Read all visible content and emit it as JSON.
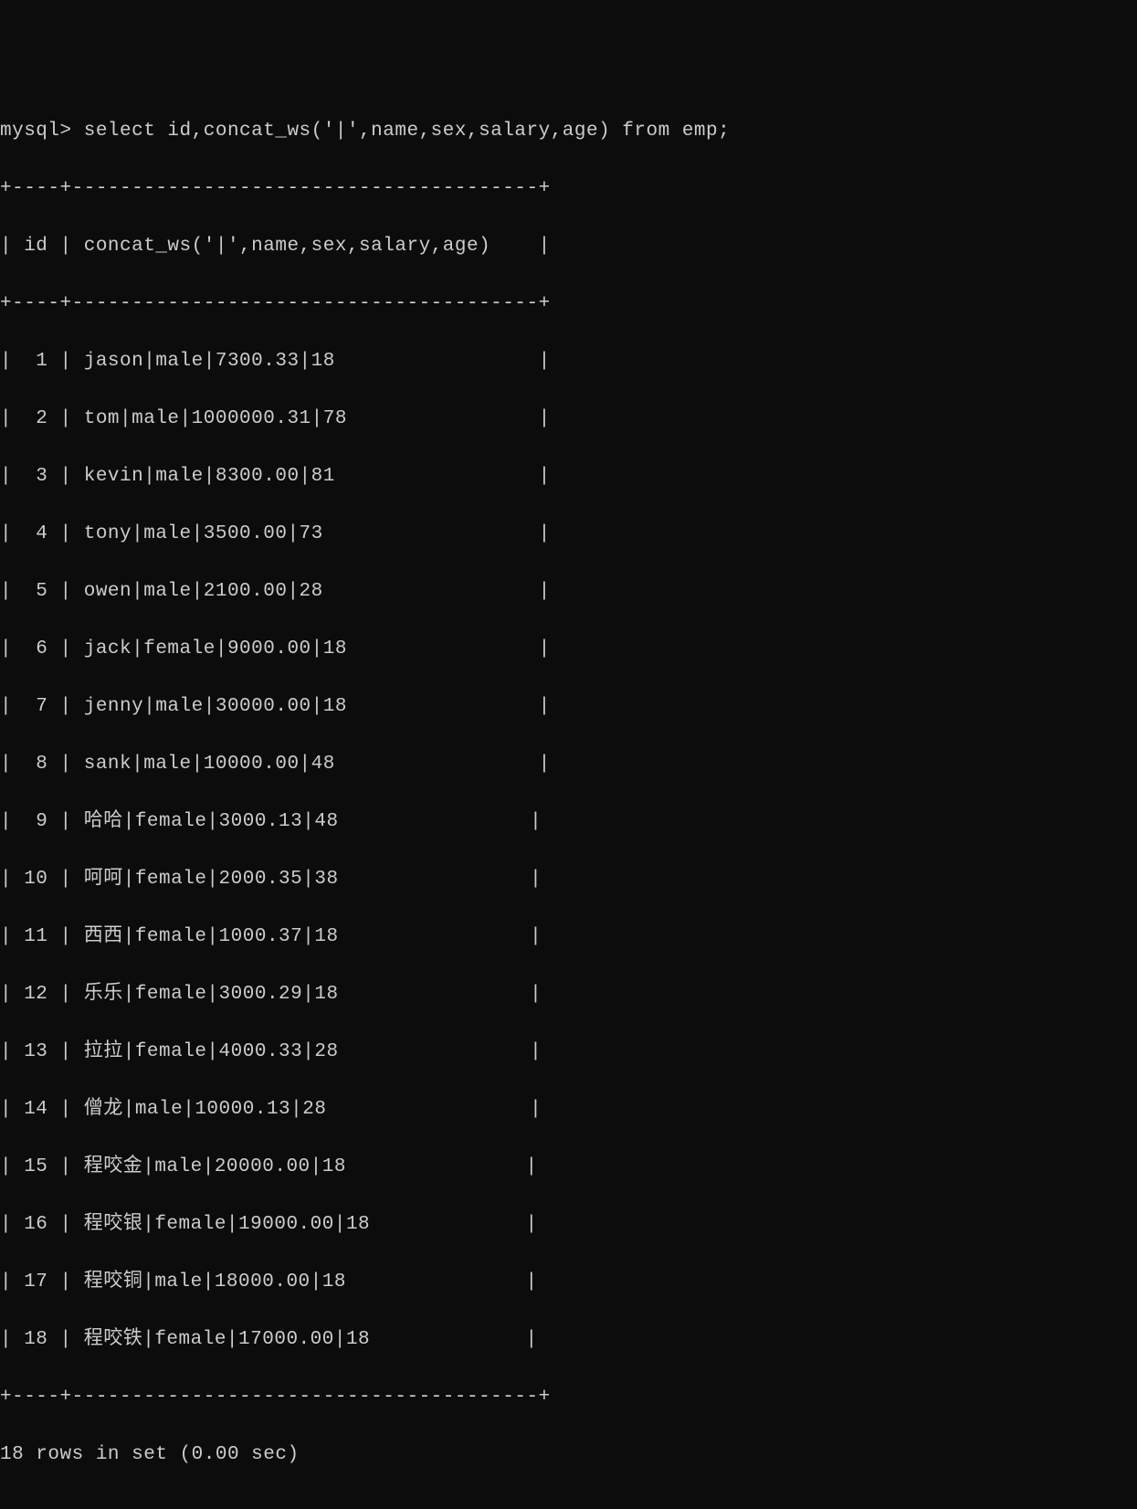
{
  "prompt": "mysql> ",
  "query": "select id,concat_ws('|',name,sex,salary,age) from emp;",
  "header_border_top": "+----+---------------------------------------+",
  "header_line": "| id | concat_ws('|',name,sex,salary,age)    |",
  "header_border_mid": "+----+---------------------------------------+",
  "rows": [
    "|  1 | jason|male|7300.33|18                 |",
    "|  2 | tom|male|1000000.31|78                |",
    "|  3 | kevin|male|8300.00|81                 |",
    "|  4 | tony|male|3500.00|73                  |",
    "|  5 | owen|male|2100.00|28                  |",
    "|  6 | jack|female|9000.00|18                |",
    "|  7 | jenny|male|30000.00|18                |",
    "|  8 | sank|male|10000.00|48                 |",
    "|  9 | 哈哈|female|3000.13|48                |",
    "| 10 | 呵呵|female|2000.35|38                |",
    "| 11 | 西西|female|1000.37|18                |",
    "| 12 | 乐乐|female|3000.29|18                |",
    "| 13 | 拉拉|female|4000.33|28                |",
    "| 14 | 僧龙|male|10000.13|28                 |",
    "| 15 | 程咬金|male|20000.00|18               |",
    "| 16 | 程咬银|female|19000.00|18             |",
    "| 17 | 程咬铜|male|18000.00|18               |",
    "| 18 | 程咬铁|female|17000.00|18             |"
  ],
  "header_border_bottom": "+----+---------------------------------------+",
  "footer": "18 rows in set (0.00 sec)",
  "chart_data": {
    "type": "table",
    "columns": [
      "id",
      "concat_ws('|',name,sex,salary,age)"
    ],
    "data": [
      {
        "id": 1,
        "concat": "jason|male|7300.33|18"
      },
      {
        "id": 2,
        "concat": "tom|male|1000000.31|78"
      },
      {
        "id": 3,
        "concat": "kevin|male|8300.00|81"
      },
      {
        "id": 4,
        "concat": "tony|male|3500.00|73"
      },
      {
        "id": 5,
        "concat": "owen|male|2100.00|28"
      },
      {
        "id": 6,
        "concat": "jack|female|9000.00|18"
      },
      {
        "id": 7,
        "concat": "jenny|male|30000.00|18"
      },
      {
        "id": 8,
        "concat": "sank|male|10000.00|48"
      },
      {
        "id": 9,
        "concat": "哈哈|female|3000.13|48"
      },
      {
        "id": 10,
        "concat": "呵呵|female|2000.35|38"
      },
      {
        "id": 11,
        "concat": "西西|female|1000.37|18"
      },
      {
        "id": 12,
        "concat": "乐乐|female|3000.29|18"
      },
      {
        "id": 13,
        "concat": "拉拉|female|4000.33|28"
      },
      {
        "id": 14,
        "concat": "僧龙|male|10000.13|28"
      },
      {
        "id": 15,
        "concat": "程咬金|male|20000.00|18"
      },
      {
        "id": 16,
        "concat": "程咬银|female|19000.00|18"
      },
      {
        "id": 17,
        "concat": "程咬铜|male|18000.00|18"
      },
      {
        "id": 18,
        "concat": "程咬铁|female|17000.00|18"
      }
    ]
  }
}
